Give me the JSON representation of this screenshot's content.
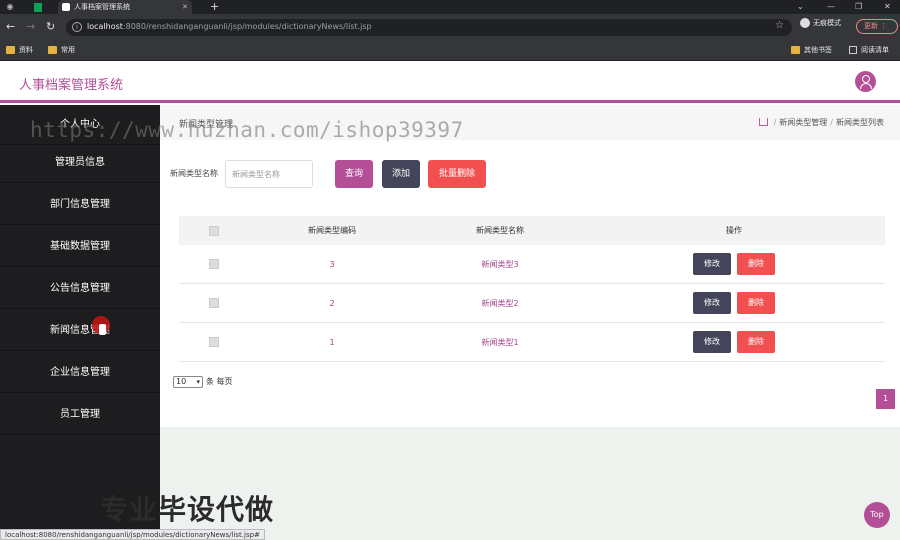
{
  "browser": {
    "tab_title": "人事档案管理系统",
    "url_host": "localhost",
    "url_rest": ":8080/renshidanganguanli/jsp/modules/dictionaryNews/list.jsp",
    "incognito_label": "无痕模式",
    "update_label": "更新",
    "bookmarks": [
      "资料",
      "常用"
    ],
    "bookmarks_right": [
      "其他书签",
      "阅读清单"
    ],
    "status_url": "localhost:8080/renshidanganguanli/jsp/modules/dictionaryNews/list.jsp#"
  },
  "app": {
    "title": "人事档案管理系统"
  },
  "sidebar": {
    "items": [
      {
        "label": "个人中心"
      },
      {
        "label": "管理员信息"
      },
      {
        "label": "部门信息管理"
      },
      {
        "label": "基础数据管理"
      },
      {
        "label": "公告信息管理"
      },
      {
        "label": "新闻信息管理"
      },
      {
        "label": "企业信息管理"
      },
      {
        "label": "员工管理"
      }
    ]
  },
  "main": {
    "page_name": "新闻类型管理",
    "breadcrumb": [
      "新闻类型管理",
      "新闻类型列表"
    ],
    "search": {
      "label": "新闻类型名称",
      "placeholder": "新闻类型名称",
      "value": ""
    },
    "buttons": {
      "query": "查询",
      "add": "添加",
      "batch_delete": "批量删除"
    },
    "table": {
      "headers": [
        "新闻类型编码",
        "新闻类型名称",
        "操作"
      ],
      "rows": [
        {
          "code": "3",
          "name": "新闻类型3",
          "edit": "修改",
          "delete": "删除"
        },
        {
          "code": "2",
          "name": "新闻类型2",
          "edit": "修改",
          "delete": "删除"
        },
        {
          "code": "1",
          "name": "新闻类型1",
          "edit": "修改",
          "delete": "删除"
        }
      ]
    },
    "pagination": {
      "page_size": "10",
      "per_page_suffix": "条 每页",
      "current_page": "1"
    }
  },
  "overlay": {
    "watermark_url": "https://www.huzhan.com/ishop39397",
    "watermark_cn": "专业毕设代做",
    "top_button": "Top"
  },
  "colors": {
    "accent": "#b44f97",
    "sidebar_bg": "#1d1d1f",
    "danger": "#f25050",
    "dark_button": "#44445a"
  }
}
